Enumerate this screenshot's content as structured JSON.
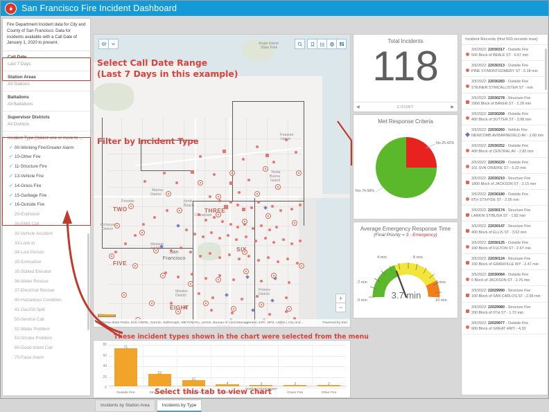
{
  "window": {
    "title": "San Francisco Fire Incident Dashboard",
    "logo_icon": "fire-badge-icon"
  },
  "sidebar": {
    "description": "Fire Department Incident data for City and County of San Francisco. Data for incidents available with a Call Date of January 1, 2020 to present.",
    "filters": [
      {
        "label": "Call Date",
        "value": "Last 7 Days"
      },
      {
        "label": "Station Areas",
        "value": "All Stations"
      },
      {
        "label": "Battalions",
        "value": "All Battalions"
      },
      {
        "label": "Supervisor Districts",
        "value": "All Districts"
      }
    ],
    "incident_type_title": "Incident Type (Select one or more to ...",
    "incident_types": [
      {
        "label": "00-Working Fire/Greater Alarm",
        "selected": true
      },
      {
        "label": "10-Other Fire",
        "selected": true
      },
      {
        "label": "11-Structure Fire",
        "selected": true
      },
      {
        "label": "13-Vehicle Fire",
        "selected": true
      },
      {
        "label": "14-Grass Fire",
        "selected": true
      },
      {
        "label": "15-Garbage Fire",
        "selected": true
      },
      {
        "label": "16-Outside Fire",
        "selected": true
      },
      {
        "label": "20-Explosion",
        "selected": false
      },
      {
        "label": "30-EMS Call",
        "selected": false
      },
      {
        "label": "32-Vehicle Accident",
        "selected": false
      },
      {
        "label": "33-Lock In",
        "selected": false
      },
      {
        "label": "34-Lost Person",
        "selected": false
      },
      {
        "label": "35-Extrication",
        "selected": false
      },
      {
        "label": "35-Stalled Elevator",
        "selected": false
      },
      {
        "label": "36-Water Rescue",
        "selected": false
      },
      {
        "label": "37-Electrical Rescue",
        "selected": false
      },
      {
        "label": "40-Hazardous Condition",
        "selected": false
      },
      {
        "label": "41-Gas/Oil Spill",
        "selected": false
      },
      {
        "label": "50-Service Call",
        "selected": false
      },
      {
        "label": "52-Water Problem",
        "selected": false
      },
      {
        "label": "53-Smoke Problem",
        "selected": false
      },
      {
        "label": "60-Good Intent Call",
        "selected": false
      },
      {
        "label": "70-False Alarm",
        "selected": false
      }
    ]
  },
  "annotations": {
    "call_date": "Select Call Date Range\n(Last 7 Days in this example)",
    "call_date_line1": "Select Call Date Range",
    "call_date_line2": "(Last 7 Days in this example)",
    "filter_type": "Filter by Incident Type",
    "chart_note": "These incident types shown in the chart were selected from the menu",
    "tab_note": "Select this tab to view chart"
  },
  "map": {
    "toolbar_left": [
      "layers-icon",
      "chevron-down-icon"
    ],
    "toolbar_right": [
      "search-icon",
      "bookmark-icon",
      "legend-icon",
      "basemap-icon",
      "widgets-icon"
    ],
    "zoom_in": "+",
    "zoom_out": "−",
    "scale_label": "2 km",
    "attribution": "California State Parks, Esri, HERE, Garmin, SafeGraph, METI/NASA, USGS, Bureau of Land Management, EPA, NPS, USDA | City and ...",
    "powered_by": "Powered by Esri",
    "city_label": "San\nFrancisco",
    "city_label_line1": "San",
    "city_label_line2": "Francisco",
    "district_labels": [
      "TWO",
      "THREE",
      "FIVE",
      "SIX",
      "EIGHT",
      "NINE"
    ],
    "place_labels": [
      "Angel Island State Park",
      "Marina District",
      "North Beach",
      "Chinatown",
      "Western Addition",
      "Mission District",
      "Potrero District",
      "Richmond District",
      "Presidio",
      "Treasure Island",
      "Yerba Buena Island"
    ]
  },
  "kpi": {
    "total": {
      "title": "Total Incidents",
      "value": "118",
      "footer": "COUNT"
    },
    "pie": {
      "title": "Met  Response Criteria",
      "label_no": "No 25.42%",
      "label_yes": "Yes 74.58%",
      "slices": [
        {
          "name": "Yes",
          "percent": 74.58,
          "color": "#5cb82b"
        },
        {
          "name": "No",
          "percent": 25.42,
          "color": "#e8231f"
        }
      ]
    },
    "gauge": {
      "title": "Average Emergency Response Time",
      "subtitle_prefix": "(Final Priority = ",
      "subtitle_value": "3 - Emergency",
      "subtitle_suffix": ")",
      "value": "3.7 min",
      "ticks": [
        "0 min",
        "2 min",
        "4 min",
        "6 min",
        "8 min",
        "10 min"
      ],
      "min": 0,
      "max": 10,
      "needle": 3.7
    }
  },
  "records": {
    "header": "Incident Records (first 500 records max)",
    "items": [
      {
        "symbol": "circle",
        "line1": "3/6/2022: ",
        "id": "22030317",
        "type": " - Outside Fire",
        "line2": "500 Block of BEALE ST - 6.67 min"
      },
      {
        "symbol": "circle",
        "line1": "3/6/2022: ",
        "id": "22030313",
        "type": " - Outside Fire",
        "line2": "PINE ST/MONTGOMERY ST - 5.18 min"
      },
      {
        "symbol": "circle",
        "line1": "3/5/2022: ",
        "id": "22030283",
        "type": " - Outside Fire",
        "line2": "STEINER ST/MCALLISTER ST -  min"
      },
      {
        "symbol": "square",
        "line1": "3/5/2022: ",
        "id": "22030278",
        "type": " - Structure Fire",
        "line2": "2900 Block of BAKER ST - 2.28 min"
      },
      {
        "symbol": "circle",
        "line1": "3/5/2022: ",
        "id": "22030268",
        "type": " - Outside Fire",
        "line2": "400 Block of SUTTER ST - 3.98 min"
      },
      {
        "symbol": "diamond",
        "line1": "3/5/2022: ",
        "id": "22030260",
        "type": " - Vehicle Fire",
        "line2": "NEWCOMB AV/BARNEVELD AV - 2.60 min"
      },
      {
        "symbol": "circle",
        "line1": "3/5/2022: ",
        "id": "22030252",
        "type": " - Outside Fire",
        "line2": "400 Block of CENTRAL AV - 2.83 min"
      },
      {
        "symbol": "circle",
        "line1": "3/5/2022: ",
        "id": "22030229",
        "type": " - Outside Fire",
        "line2": "101 SVN ON/ERIE ST - 5.22 min"
      },
      {
        "symbol": "square",
        "line1": "3/5/2022: ",
        "id": "22030210",
        "type": " - Structure Fire",
        "line2": "1800 Block of JACKSON ST - 2.15 min"
      },
      {
        "symbol": "circle",
        "line1": "3/5/2022: ",
        "id": "22030180",
        "type": " - Outside Fire",
        "line2": "8TH ST/HYDE ST - 2.05 min"
      },
      {
        "symbol": "square",
        "line1": "3/5/2022: ",
        "id": "22030174",
        "type": " - Structure Fire",
        "line2": "LARKIN ST/BUSH ST - 1.82 min"
      },
      {
        "symbol": "square",
        "line1": "3/5/2022: ",
        "id": "22030147",
        "type": " - Structure Fire",
        "line2": "400 Block of ELLIS ST - 3.62 min"
      },
      {
        "symbol": "circle",
        "line1": "3/5/2022: ",
        "id": "22030125",
        "type": " - Outside Fire",
        "line2": "100 Block of FULTON ST - 2.67 min"
      },
      {
        "symbol": "square",
        "line1": "3/5/2022: ",
        "id": "22030124",
        "type": " - Structure Fire",
        "line2": "100 Block of GRANVILLE WY - 2.47 min"
      },
      {
        "symbol": "circle",
        "line1": "3/5/2022: ",
        "id": "22030084",
        "type": " - Outside Fire",
        "line2": "0 Block of JACKSON ST - 2.76 min"
      },
      {
        "symbol": "square",
        "line1": "3/5/2022: ",
        "id": "22029990",
        "type": " - Structure Fire",
        "line2": "100 Block of SAN CARLOS ST - 2.58 min"
      },
      {
        "symbol": "square",
        "line1": "3/5/2022: ",
        "id": "22029980",
        "type": " - Structure Fire",
        "line2": "200 Block of 6TH ST - 1.72 min"
      },
      {
        "symbol": "circle",
        "line1": "3/5/2022: ",
        "id": "22029977",
        "type": " - Outside Fire",
        "line2": "900 Block of GREAT HWY - 4.33"
      }
    ]
  },
  "tabs": [
    {
      "label": "Incidents by Station Area",
      "active": false
    },
    {
      "label": "Incidents by Type",
      "active": true
    }
  ],
  "chart_data": {
    "type": "bar",
    "title": "Incidents by Type",
    "categories": [
      "Outside Fire",
      "Structure Fire",
      "Garbage Fire",
      "Vehicle Fire",
      "Working Fire/Greater Alarm",
      "Grass Fire",
      "Other Fire"
    ],
    "values": [
      71,
      23,
      12,
      4,
      3,
      3,
      2
    ],
    "xlabel": "",
    "ylabel": "",
    "ylim": [
      0,
      80
    ],
    "yticks": [
      0,
      20,
      40,
      60,
      80
    ],
    "bar_color": "#f2a42a",
    "grid": true,
    "legend": "none"
  }
}
